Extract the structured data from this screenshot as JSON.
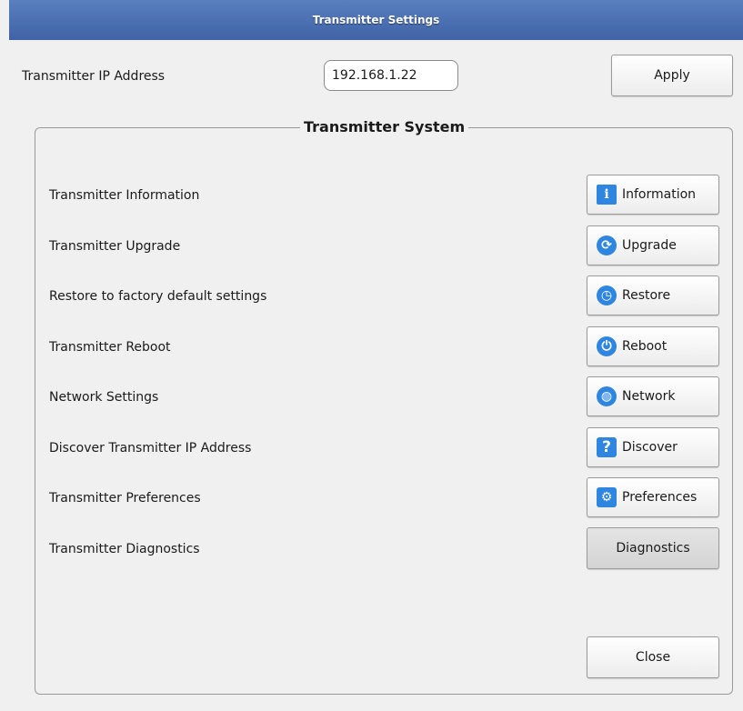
{
  "window": {
    "title": "Transmitter Settings"
  },
  "ip": {
    "label": "Transmitter IP Address",
    "value": "192.168.1.22",
    "apply_label": "Apply"
  },
  "group": {
    "title": "Transmitter System",
    "rows": [
      {
        "label": "Transmitter Information",
        "button": "Information",
        "icon": "info-icon"
      },
      {
        "label": "Transmitter Upgrade",
        "button": "Upgrade",
        "icon": "refresh-icon"
      },
      {
        "label": "Restore to factory default settings",
        "button": "Restore",
        "icon": "history-icon"
      },
      {
        "label": "Transmitter Reboot",
        "button": "Reboot",
        "icon": "power-icon"
      },
      {
        "label": "Network Settings",
        "button": "Network",
        "icon": "globe-icon"
      },
      {
        "label": "Discover Transmitter IP Address",
        "button": "Discover",
        "icon": "question-icon"
      },
      {
        "label": "Transmitter Preferences",
        "button": "Preferences",
        "icon": "gear-icon"
      },
      {
        "label": "Transmitter Diagnostics",
        "button": "Diagnostics"
      }
    ],
    "close_label": "Close"
  },
  "colors": {
    "titlebar": "#4a6fb0",
    "icon_blue": "#2e86e0"
  }
}
